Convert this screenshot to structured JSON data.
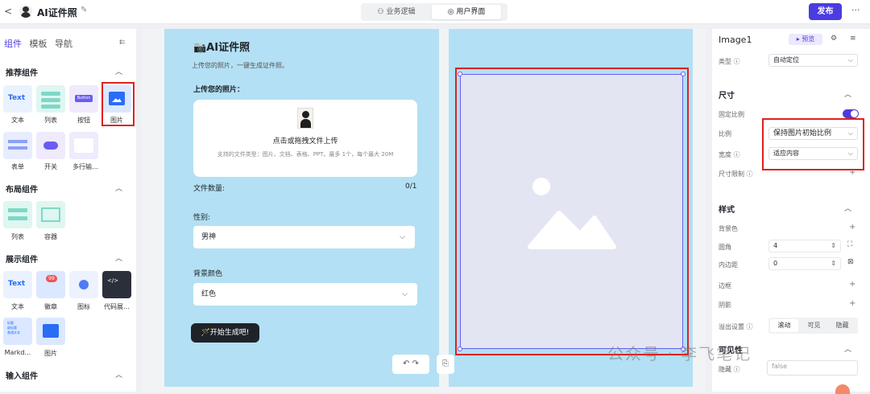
{
  "header": {
    "back": "<",
    "title": "AI证件照",
    "edit": "✎",
    "tab_logic": "业务逻辑",
    "tab_ui": "用户界面",
    "publish": "发布",
    "more": "···"
  },
  "left": {
    "tabs": [
      "组件",
      "模板",
      "导航"
    ],
    "sections": {
      "recommended": "推荐组件",
      "layout": "布局组件",
      "display": "展示组件",
      "input": "输入组件"
    },
    "recommended": [
      "文本",
      "列表",
      "按钮",
      "图片",
      "表单",
      "开关",
      "多行输…"
    ],
    "layout": [
      "列表",
      "容器"
    ],
    "display": [
      "文本",
      "徽章",
      "图标",
      "代码展…",
      "Markd…",
      "图片"
    ],
    "badge": "99",
    "text_thumb": "Text",
    "button_thumb": "Button",
    "md_thumb": "标题\n副标题\n普通文本"
  },
  "app": {
    "title": "📷AI证件照",
    "subtitle": "上传您的照片，一键生成证件照。",
    "upload_label": "上传您的照片：",
    "upload_main": "点击或拖拽文件上传",
    "upload_hint": "支持的文件类型：图片、文档、表格、PPT。最多 1个，每个最大 20M",
    "file_count_label": "文件数量:",
    "file_count": "0/1",
    "gender_label": "性别:",
    "gender_value": "男神",
    "bg_label": "背景颜色",
    "bg_value": "红色",
    "generate": "🪄开始生成吧!"
  },
  "right": {
    "name": "Image1",
    "preview": "预览",
    "type_label": "类型",
    "type_value": "自动定位",
    "size": "尺寸",
    "fixed_ratio": "固定比例",
    "ratio": "比例",
    "ratio_value": "保持图片初始比例",
    "width": "宽度",
    "width_value": "适应内容",
    "size_limit": "尺寸限制",
    "style": "样式",
    "bg": "背景色",
    "radius": "圆角",
    "radius_value": "4",
    "padding": "内边距",
    "padding_value": "0",
    "border": "边框",
    "shadow": "阴影",
    "overflow": "溢出设置",
    "of_scroll": "滚动",
    "of_visible": "可见",
    "of_hidden": "隐藏",
    "visibility": "可见性",
    "hidden": "隐藏",
    "hidden_value": "false"
  },
  "watermark": "公众号 · 李飞笔记",
  "colors": {
    "accent": "#4b3ce0",
    "highlight": "#e02020",
    "canvas_bg": "#b3e0f4"
  }
}
